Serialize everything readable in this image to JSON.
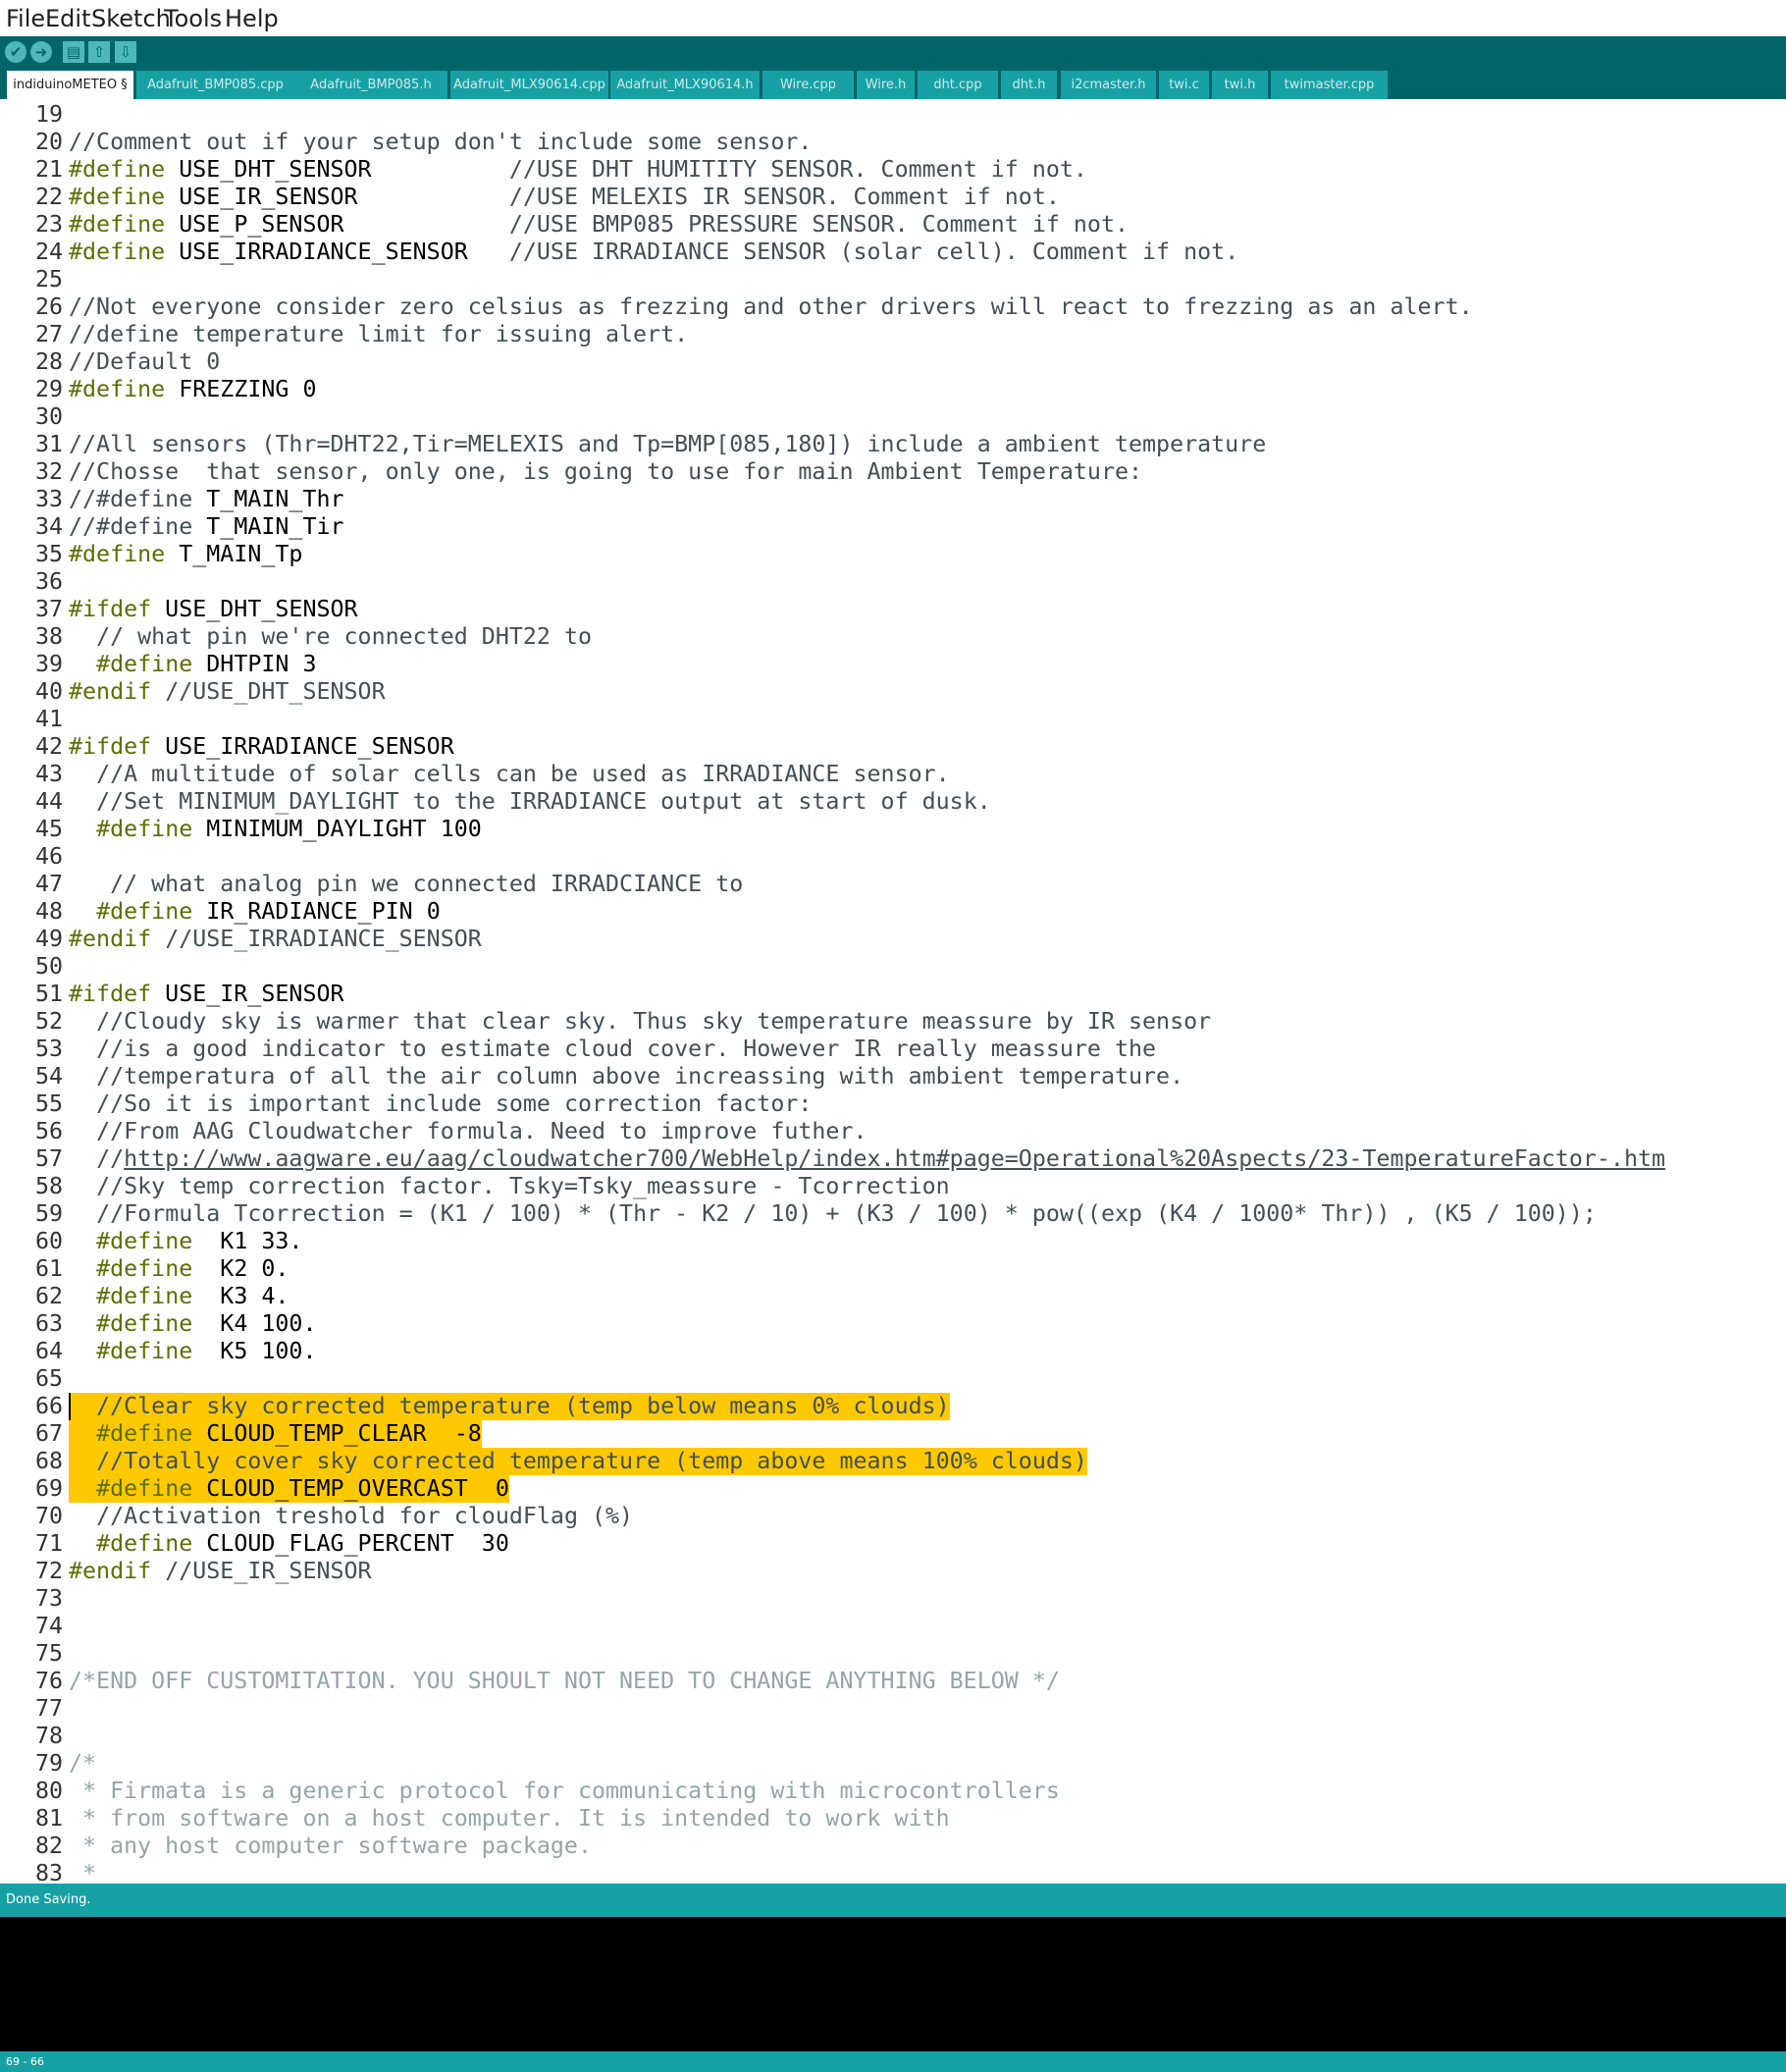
{
  "menu": [
    "File",
    "Edit",
    "Sketch",
    "Tools",
    "Help"
  ],
  "toolbar": [
    {
      "name": "verify-icon",
      "glyph": "✔",
      "round": true
    },
    {
      "name": "upload-icon",
      "glyph": "➜",
      "round": true
    },
    {
      "name": "new-icon",
      "glyph": "▤",
      "round": false
    },
    {
      "name": "open-icon",
      "glyph": "⇧",
      "round": false
    },
    {
      "name": "save-icon",
      "glyph": "⇩",
      "round": false
    }
  ],
  "tabs": [
    {
      "label": "indiduinoMETEO §",
      "active": true
    },
    {
      "label": "Adafruit_BMP085.cpp",
      "active": false
    },
    {
      "label": "Adafruit_BMP085.h",
      "active": false
    },
    {
      "label": "Adafruit_MLX90614.cpp",
      "active": false
    },
    {
      "label": "Adafruit_MLX90614.h",
      "active": false
    },
    {
      "label": "Wire.cpp",
      "active": false
    },
    {
      "label": "Wire.h",
      "active": false
    },
    {
      "label": "dht.cpp",
      "active": false
    },
    {
      "label": "dht.h",
      "active": false
    },
    {
      "label": "i2cmaster.h",
      "active": false
    },
    {
      "label": "twi.c",
      "active": false
    },
    {
      "label": "twi.h",
      "active": false
    },
    {
      "label": "twimaster.cpp",
      "active": false
    }
  ],
  "colors": {
    "toolbar": "#006468",
    "tab": "#17a1a5",
    "highlight": "#ffc901",
    "keyword": "#5e6d03",
    "comment": "#434f54"
  },
  "code_lines": [
    {
      "n": "19",
      "hl": false,
      "seg": []
    },
    {
      "n": "20",
      "hl": false,
      "seg": [
        [
          "c",
          "//Comment out if your setup don't include some sensor."
        ]
      ]
    },
    {
      "n": "21",
      "hl": false,
      "seg": [
        [
          "k",
          "#define"
        ],
        [
          "t",
          " USE_DHT_SENSOR          "
        ],
        [
          "c",
          "//USE DHT HUMITITY SENSOR. Comment if not."
        ]
      ]
    },
    {
      "n": "22",
      "hl": false,
      "seg": [
        [
          "k",
          "#define"
        ],
        [
          "t",
          " USE_IR_SENSOR           "
        ],
        [
          "c",
          "//USE MELEXIS IR SENSOR. Comment if not."
        ]
      ]
    },
    {
      "n": "23",
      "hl": false,
      "seg": [
        [
          "k",
          "#define"
        ],
        [
          "t",
          " USE_P_SENSOR            "
        ],
        [
          "c",
          "//USE BMP085 PRESSURE SENSOR. Comment if not."
        ]
      ]
    },
    {
      "n": "24",
      "hl": false,
      "seg": [
        [
          "k",
          "#define"
        ],
        [
          "t",
          " USE_IRRADIANCE_SENSOR   "
        ],
        [
          "c",
          "//USE IRRADIANCE SENSOR (solar cell). Comment if not."
        ]
      ]
    },
    {
      "n": "25",
      "hl": false,
      "seg": []
    },
    {
      "n": "26",
      "hl": false,
      "seg": [
        [
          "c",
          "//Not everyone consider zero celsius as frezzing and other drivers will react to frezzing as an alert."
        ]
      ]
    },
    {
      "n": "27",
      "hl": false,
      "seg": [
        [
          "c",
          "//define temperature limit for issuing alert."
        ]
      ]
    },
    {
      "n": "28",
      "hl": false,
      "seg": [
        [
          "c",
          "//Default 0"
        ]
      ]
    },
    {
      "n": "29",
      "hl": false,
      "seg": [
        [
          "k",
          "#define"
        ],
        [
          "t",
          " FREZZING 0"
        ]
      ]
    },
    {
      "n": "30",
      "hl": false,
      "seg": []
    },
    {
      "n": "31",
      "hl": false,
      "seg": [
        [
          "c",
          "//All sensors (Thr=DHT22,Tir=MELEXIS and Tp=BMP[085,180]) include a ambient temperature"
        ]
      ]
    },
    {
      "n": "32",
      "hl": false,
      "seg": [
        [
          "c",
          "//Chosse  that sensor, only one, is going to use for main Ambient Temperature:"
        ]
      ]
    },
    {
      "n": "33",
      "hl": false,
      "seg": [
        [
          "c",
          "//#define "
        ],
        [
          "t",
          "T_MAIN_Thr"
        ]
      ]
    },
    {
      "n": "34",
      "hl": false,
      "seg": [
        [
          "c",
          "//#define "
        ],
        [
          "t",
          "T_MAIN_Tir"
        ]
      ]
    },
    {
      "n": "35",
      "hl": false,
      "seg": [
        [
          "k",
          "#define"
        ],
        [
          "t",
          " T_MAIN_Tp"
        ]
      ]
    },
    {
      "n": "36",
      "hl": false,
      "seg": []
    },
    {
      "n": "37",
      "hl": false,
      "seg": [
        [
          "k",
          "#ifdef"
        ],
        [
          "t",
          " USE_DHT_SENSOR"
        ]
      ]
    },
    {
      "n": "38",
      "hl": false,
      "seg": [
        [
          "t",
          "  "
        ],
        [
          "c",
          "// what pin we're connected DHT22 to"
        ]
      ]
    },
    {
      "n": "39",
      "hl": false,
      "seg": [
        [
          "t",
          "  "
        ],
        [
          "k",
          "#define"
        ],
        [
          "t",
          " DHTPIN 3"
        ]
      ]
    },
    {
      "n": "40",
      "hl": false,
      "seg": [
        [
          "k",
          "#endif"
        ],
        [
          "t",
          " "
        ],
        [
          "c",
          "//USE_DHT_SENSOR"
        ]
      ]
    },
    {
      "n": "41",
      "hl": false,
      "seg": []
    },
    {
      "n": "42",
      "hl": false,
      "seg": [
        [
          "k",
          "#ifdef"
        ],
        [
          "t",
          " USE_IRRADIANCE_SENSOR"
        ]
      ]
    },
    {
      "n": "43",
      "hl": false,
      "seg": [
        [
          "t",
          "  "
        ],
        [
          "c",
          "//A multitude of solar cells can be used as IRRADIANCE sensor."
        ]
      ]
    },
    {
      "n": "44",
      "hl": false,
      "seg": [
        [
          "t",
          "  "
        ],
        [
          "c",
          "//Set MINIMUM_DAYLIGHT to the IRRADIANCE output at start of dusk."
        ]
      ]
    },
    {
      "n": "45",
      "hl": false,
      "seg": [
        [
          "t",
          "  "
        ],
        [
          "k",
          "#define"
        ],
        [
          "t",
          " MINIMUM_DAYLIGHT 100"
        ]
      ]
    },
    {
      "n": "46",
      "hl": false,
      "seg": []
    },
    {
      "n": "47",
      "hl": false,
      "seg": [
        [
          "t",
          "   "
        ],
        [
          "c",
          "// what analog pin we connected IRRADCIANCE to"
        ]
      ]
    },
    {
      "n": "48",
      "hl": false,
      "seg": [
        [
          "t",
          "  "
        ],
        [
          "k",
          "#define"
        ],
        [
          "t",
          " IR_RADIANCE_PIN 0"
        ]
      ]
    },
    {
      "n": "49",
      "hl": false,
      "seg": [
        [
          "k",
          "#endif"
        ],
        [
          "t",
          " "
        ],
        [
          "c",
          "//USE_IRRADIANCE_SENSOR"
        ]
      ]
    },
    {
      "n": "50",
      "hl": false,
      "seg": []
    },
    {
      "n": "51",
      "hl": false,
      "seg": [
        [
          "k",
          "#ifdef"
        ],
        [
          "t",
          " USE_IR_SENSOR"
        ]
      ]
    },
    {
      "n": "52",
      "hl": false,
      "seg": [
        [
          "t",
          "  "
        ],
        [
          "c",
          "//Cloudy sky is warmer that clear sky. Thus sky temperature meassure by IR sensor"
        ]
      ]
    },
    {
      "n": "53",
      "hl": false,
      "seg": [
        [
          "t",
          "  "
        ],
        [
          "c",
          "//is a good indicator to estimate cloud cover. However IR really meassure the"
        ]
      ]
    },
    {
      "n": "54",
      "hl": false,
      "seg": [
        [
          "t",
          "  "
        ],
        [
          "c",
          "//temperatura of all the air column above increassing with ambient temperature."
        ]
      ]
    },
    {
      "n": "55",
      "hl": false,
      "seg": [
        [
          "t",
          "  "
        ],
        [
          "c",
          "//So it is important include some correction factor:"
        ]
      ]
    },
    {
      "n": "56",
      "hl": false,
      "seg": [
        [
          "t",
          "  "
        ],
        [
          "c",
          "//From AAG Cloudwatcher formula. Need to improve futher."
        ]
      ]
    },
    {
      "n": "57",
      "hl": false,
      "seg": [
        [
          "t",
          "  "
        ],
        [
          "c",
          "//"
        ],
        [
          "l",
          "http://www.aagware.eu/aag/cloudwatcher700/WebHelp/index.htm#page=Operational%20Aspects/23-TemperatureFactor-.htm"
        ]
      ]
    },
    {
      "n": "58",
      "hl": false,
      "seg": [
        [
          "t",
          "  "
        ],
        [
          "c",
          "//Sky temp correction factor. Tsky=Tsky_meassure - Tcorrection"
        ]
      ]
    },
    {
      "n": "59",
      "hl": false,
      "seg": [
        [
          "t",
          "  "
        ],
        [
          "c",
          "//Formula Tcorrection = (K1 / 100) * (Thr - K2 / 10) + (K3 / 100) * pow((exp (K4 / 1000* Thr)) , (K5 / 100));"
        ]
      ]
    },
    {
      "n": "60",
      "hl": false,
      "seg": [
        [
          "t",
          "  "
        ],
        [
          "k",
          "#define"
        ],
        [
          "t",
          "  K1 33."
        ]
      ]
    },
    {
      "n": "61",
      "hl": false,
      "seg": [
        [
          "t",
          "  "
        ],
        [
          "k",
          "#define"
        ],
        [
          "t",
          "  K2 0."
        ]
      ]
    },
    {
      "n": "62",
      "hl": false,
      "seg": [
        [
          "t",
          "  "
        ],
        [
          "k",
          "#define"
        ],
        [
          "t",
          "  K3 4."
        ]
      ]
    },
    {
      "n": "63",
      "hl": false,
      "seg": [
        [
          "t",
          "  "
        ],
        [
          "k",
          "#define"
        ],
        [
          "t",
          "  K4 100."
        ]
      ]
    },
    {
      "n": "64",
      "hl": false,
      "seg": [
        [
          "t",
          "  "
        ],
        [
          "k",
          "#define"
        ],
        [
          "t",
          "  K5 100."
        ]
      ]
    },
    {
      "n": "65",
      "hl": false,
      "seg": []
    },
    {
      "n": "66",
      "hl": true,
      "seg": [
        [
          "t",
          "  "
        ],
        [
          "c",
          "//Clear sky corrected temperature (temp below means 0% clouds)"
        ]
      ]
    },
    {
      "n": "67",
      "hl": true,
      "seg": [
        [
          "t",
          "  "
        ],
        [
          "k",
          "#define"
        ],
        [
          "t",
          " CLOUD_TEMP_CLEAR  -8"
        ]
      ]
    },
    {
      "n": "68",
      "hl": true,
      "seg": [
        [
          "t",
          "  "
        ],
        [
          "c",
          "//Totally cover sky corrected temperature (temp above means 100% clouds)"
        ]
      ]
    },
    {
      "n": "69",
      "hl": true,
      "seg": [
        [
          "t",
          "  "
        ],
        [
          "k",
          "#define"
        ],
        [
          "t",
          " CLOUD_TEMP_OVERCAST  0"
        ]
      ]
    },
    {
      "n": "70",
      "hl": false,
      "seg": [
        [
          "t",
          "  "
        ],
        [
          "c",
          "//Activation treshold for cloudFlag (%)"
        ]
      ]
    },
    {
      "n": "71",
      "hl": false,
      "seg": [
        [
          "t",
          "  "
        ],
        [
          "k",
          "#define"
        ],
        [
          "t",
          " CLOUD_FLAG_PERCENT  30"
        ]
      ]
    },
    {
      "n": "72",
      "hl": false,
      "seg": [
        [
          "k",
          "#endif"
        ],
        [
          "t",
          " "
        ],
        [
          "c",
          "//USE_IR_SENSOR"
        ]
      ]
    },
    {
      "n": "73",
      "hl": false,
      "seg": []
    },
    {
      "n": "74",
      "hl": false,
      "seg": []
    },
    {
      "n": "75",
      "hl": false,
      "seg": []
    },
    {
      "n": "76",
      "hl": false,
      "seg": [
        [
          "b",
          "/*END OFF CUSTOMITATION. YOU SHOULT NOT NEED TO CHANGE ANYTHING BELOW */"
        ]
      ]
    },
    {
      "n": "77",
      "hl": false,
      "seg": []
    },
    {
      "n": "78",
      "hl": false,
      "seg": []
    },
    {
      "n": "79",
      "hl": false,
      "seg": [
        [
          "b",
          "/*"
        ]
      ]
    },
    {
      "n": "80",
      "hl": false,
      "seg": [
        [
          "b",
          " * Firmata is a generic protocol for communicating with microcontrollers"
        ]
      ]
    },
    {
      "n": "81",
      "hl": false,
      "seg": [
        [
          "b",
          " * from software on a host computer. It is intended to work with"
        ]
      ]
    },
    {
      "n": "82",
      "hl": false,
      "seg": [
        [
          "b",
          " * any host computer software package."
        ]
      ]
    },
    {
      "n": "83",
      "hl": false,
      "seg": [
        [
          "b",
          " *"
        ]
      ]
    }
  ],
  "status": "Done Saving.",
  "footer": "69 - 66"
}
